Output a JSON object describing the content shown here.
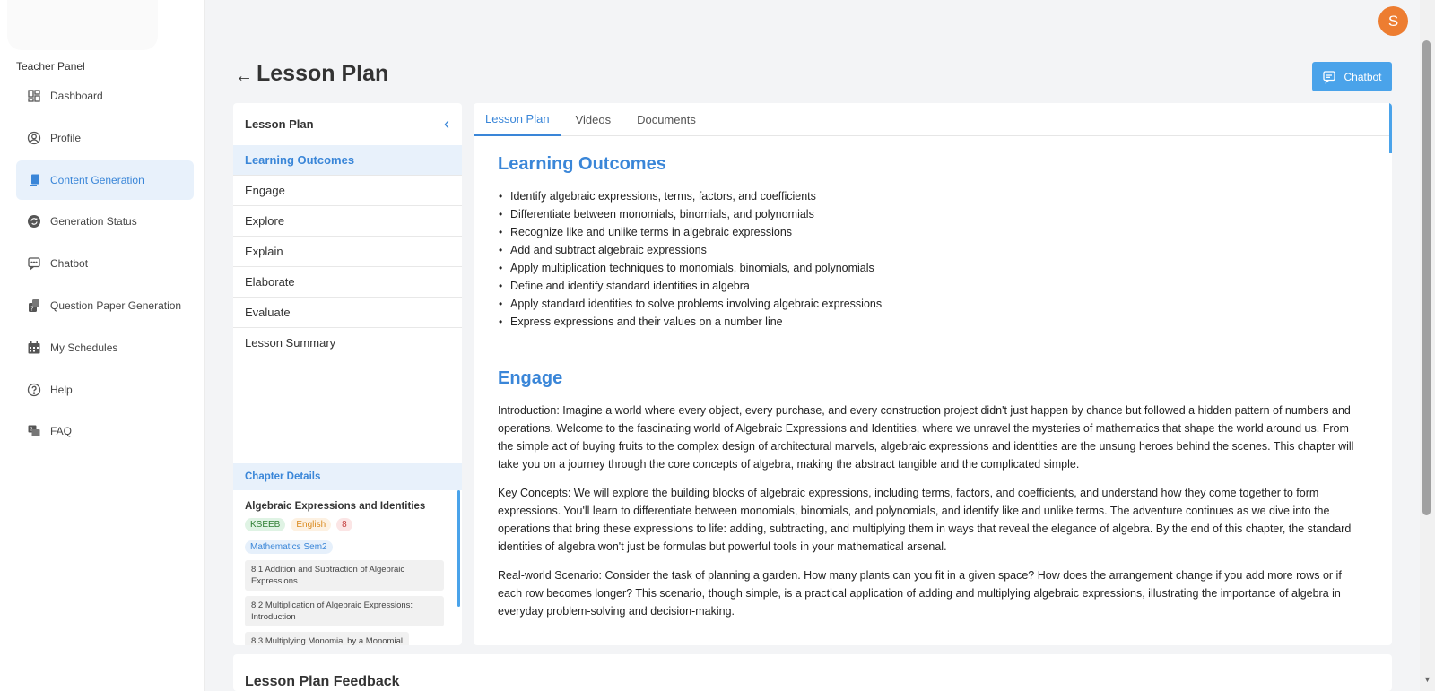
{
  "sidebar": {
    "panel_label": "Teacher Panel",
    "items": [
      {
        "label": "Dashboard",
        "icon": "dashboard-icon"
      },
      {
        "label": "Profile",
        "icon": "profile-icon"
      },
      {
        "label": "Content Generation",
        "icon": "content-icon",
        "active": true
      },
      {
        "label": "Generation Status",
        "icon": "refresh-icon"
      },
      {
        "label": "Chatbot",
        "icon": "chat-icon"
      },
      {
        "label": "Question Paper Generation",
        "icon": "question-paper-icon"
      },
      {
        "label": "My Schedules",
        "icon": "calendar-icon"
      },
      {
        "label": "Help",
        "icon": "help-icon"
      },
      {
        "label": "FAQ",
        "icon": "faq-icon"
      }
    ]
  },
  "header": {
    "avatar_letter": "S",
    "title": "Lesson Plan",
    "chatbot_label": "Chatbot"
  },
  "lesson_nav": {
    "title": "Lesson Plan",
    "items": [
      "Learning Outcomes",
      "Engage",
      "Explore",
      "Explain",
      "Elaborate",
      "Evaluate",
      "Lesson Summary"
    ],
    "active_index": 0
  },
  "chapter": {
    "header": "Chapter Details",
    "title": "Algebraic Expressions and Identities",
    "tags": [
      "KSEEB",
      "English",
      "8"
    ],
    "subject": "Mathematics Sem2",
    "sections": [
      "8.1 Addition and Subtraction of Algebraic Expressions",
      "8.2 Multiplication of Algebraic Expressions: Introduction",
      "8.3 Multiplying Monomial by a Monomial"
    ]
  },
  "tabs": [
    "Lesson Plan",
    "Videos",
    "Documents"
  ],
  "content": {
    "outcomes_title": "Learning Outcomes",
    "outcomes": [
      "Identify algebraic expressions, terms, factors, and coefficients",
      "Differentiate between monomials, binomials, and polynomials",
      "Recognize like and unlike terms in algebraic expressions",
      "Add and subtract algebraic expressions",
      "Apply multiplication techniques to monomials, binomials, and polynomials",
      "Define and identify standard identities in algebra",
      "Apply standard identities to solve problems involving algebraic expressions",
      "Express expressions and their values on a number line"
    ],
    "engage_title": "Engage",
    "engage_paragraphs": [
      "Introduction: Imagine a world where every object, every purchase, and every construction project didn't just happen by chance but followed a hidden pattern of numbers and operations. Welcome to the fascinating world of Algebraic Expressions and Identities, where we unravel the mysteries of mathematics that shape the world around us. From the simple act of buying fruits to the complex design of architectural marvels, algebraic expressions and identities are the unsung heroes behind the scenes. This chapter will take you on a journey through the core concepts of algebra, making the abstract tangible and the complicated simple.",
      "Key Concepts: We will explore the building blocks of algebraic expressions, including terms, factors, and coefficients, and understand how they come together to form expressions. You'll learn to differentiate between monomials, binomials, and polynomials, and identify like and unlike terms. The adventure continues as we dive into the operations that bring these expressions to life: adding, subtracting, and multiplying them in ways that reveal the elegance of algebra. By the end of this chapter, the standard identities of algebra won't just be formulas but powerful tools in your mathematical arsenal.",
      "Real-world Scenario: Consider the task of planning a garden. How many plants can you fit in a given space? How does the arrangement change if you add more rows or if each row becomes longer? This scenario, though simple, is a practical application of adding and multiplying algebraic expressions, illustrating the importance of algebra in everyday problem-solving and decision-making."
    ]
  },
  "feedback": {
    "title": "Lesson Plan Feedback"
  },
  "colors": {
    "accent": "#3a86d8",
    "button": "#4aa3ea",
    "avatar": "#ed7d31"
  }
}
